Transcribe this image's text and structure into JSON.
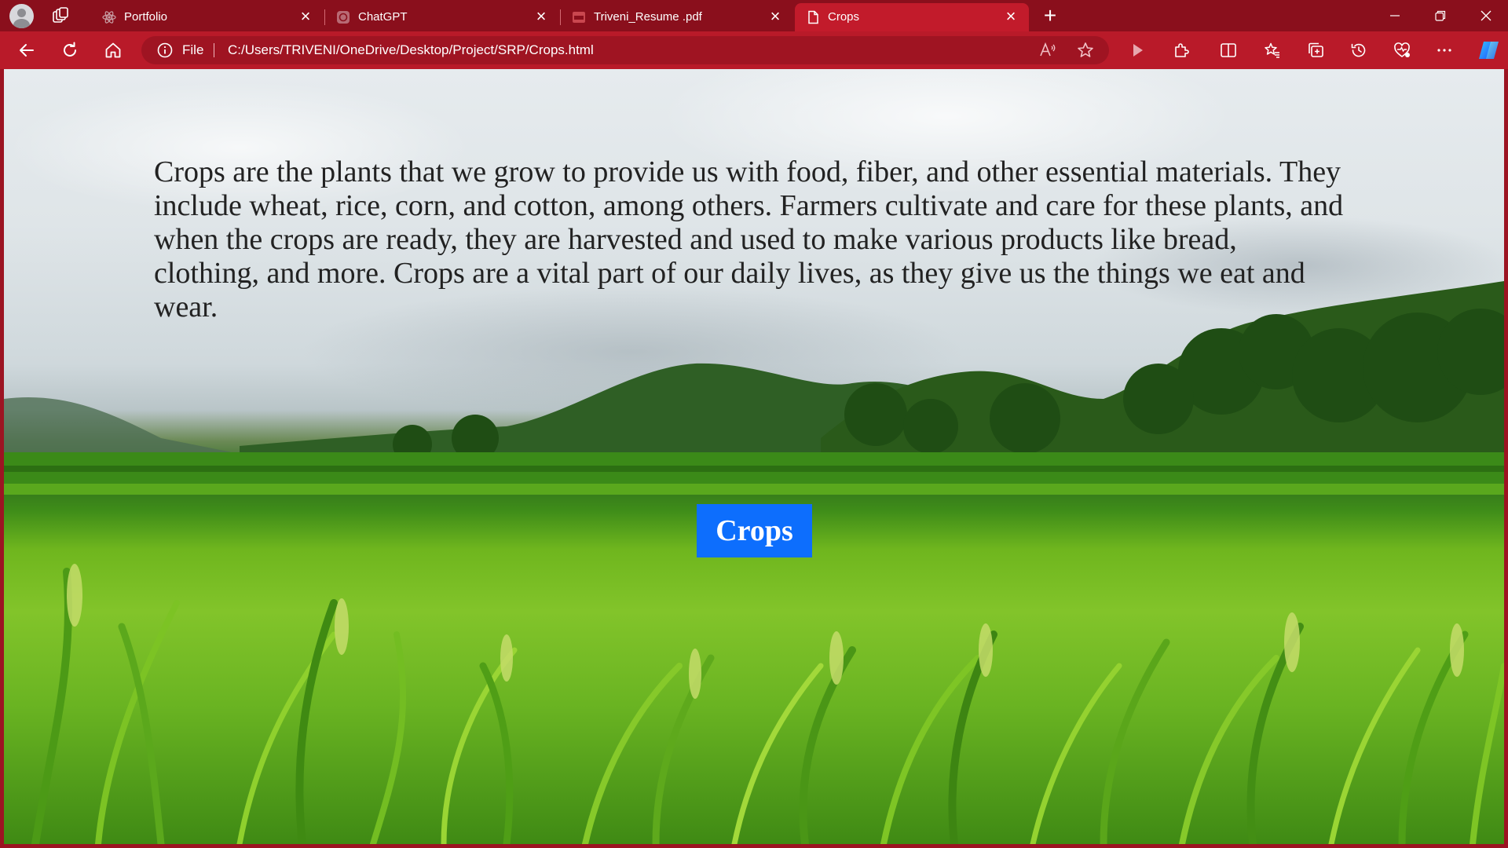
{
  "browser": {
    "tabs": [
      {
        "title": "Portfolio",
        "icon": "react-atom-icon",
        "active": false
      },
      {
        "title": "ChatGPT",
        "icon": "chatgpt-icon",
        "active": false
      },
      {
        "title": "Triveni_Resume .pdf",
        "icon": "pdf-icon",
        "active": false
      },
      {
        "title": "Crops",
        "icon": "page-icon",
        "active": true
      }
    ],
    "address": {
      "scheme_label": "File",
      "url": "C:/Users/TRIVENI/OneDrive/Desktop/Project/SRP/Crops.html"
    },
    "toolbar_icons": [
      "back-icon",
      "refresh-icon",
      "home-icon",
      "read-aloud-icon",
      "favorite-star-icon",
      "play-icon",
      "extensions-icon",
      "split-screen-icon",
      "favorites-icon",
      "collections-icon",
      "history-icon",
      "performance-icon",
      "more-icon",
      "copilot-icon"
    ],
    "colors": {
      "frame": "#8a0f1c",
      "toolbar": "#b91a29",
      "active_tab": "#c21b2b"
    }
  },
  "page": {
    "intro_text": "Crops are the plants that we grow to provide us with food, fiber, and other essential materials. They include wheat, rice, corn, and cotton, among others. Farmers cultivate and care for these plants, and when the crops are ready, they are harvested and used to make various products like bread, clothing, and more. Crops are a vital part of our daily lives, as they give us the things we eat and wear.",
    "button_label": "Crops",
    "button_color": "#0d6efd",
    "background": "rice paddy field with green hills and cloudy sky"
  }
}
